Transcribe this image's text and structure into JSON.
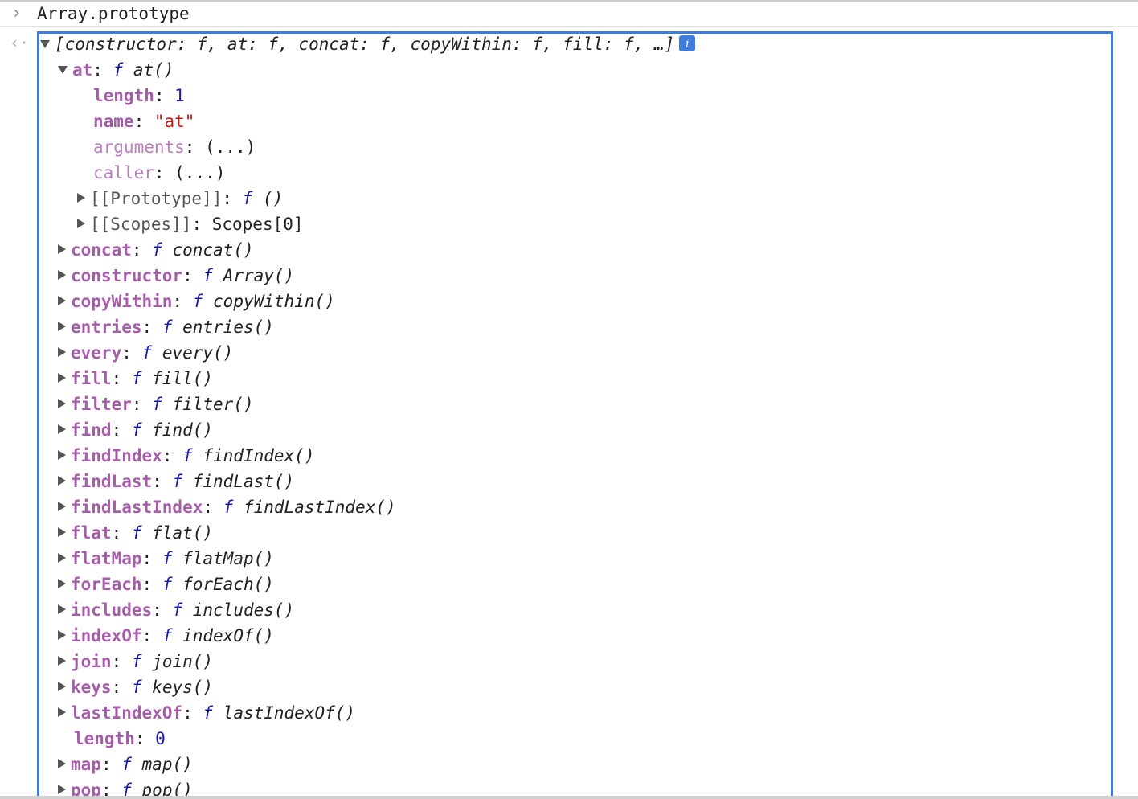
{
  "console": {
    "input_expression": "Array.prototype",
    "summary_preview": "[constructor: f, at: f, concat: f, copyWithin: f, fill: f, …]",
    "info_badge": "i",
    "expanded_at": {
      "key": "at",
      "value": "at()",
      "children": [
        {
          "key": "length",
          "value": "1"
        },
        {
          "key": "name",
          "value": "\"at\""
        },
        {
          "key": "arguments",
          "value": "(...)"
        },
        {
          "key": "caller",
          "value": "(...)"
        },
        {
          "key": "[[Prototype]]",
          "value": "()"
        },
        {
          "key": "[[Scopes]]",
          "value": "Scopes[0]"
        }
      ]
    },
    "function_symbol": "f",
    "properties": [
      {
        "key": "concat",
        "value": "concat()"
      },
      {
        "key": "constructor",
        "value": "Array()"
      },
      {
        "key": "copyWithin",
        "value": "copyWithin()"
      },
      {
        "key": "entries",
        "value": "entries()"
      },
      {
        "key": "every",
        "value": "every()"
      },
      {
        "key": "fill",
        "value": "fill()"
      },
      {
        "key": "filter",
        "value": "filter()"
      },
      {
        "key": "find",
        "value": "find()"
      },
      {
        "key": "findIndex",
        "value": "findIndex()"
      },
      {
        "key": "findLast",
        "value": "findLast()"
      },
      {
        "key": "findLastIndex",
        "value": "findLastIndex()"
      },
      {
        "key": "flat",
        "value": "flat()"
      },
      {
        "key": "flatMap",
        "value": "flatMap()"
      },
      {
        "key": "forEach",
        "value": "forEach()"
      },
      {
        "key": "includes",
        "value": "includes()"
      },
      {
        "key": "indexOf",
        "value": "indexOf()"
      },
      {
        "key": "join",
        "value": "join()"
      },
      {
        "key": "keys",
        "value": "keys()"
      },
      {
        "key": "lastIndexOf",
        "value": "lastIndexOf()"
      }
    ],
    "length_property": {
      "key": "length",
      "value": "0"
    },
    "trailing_properties": [
      {
        "key": "map",
        "value": "map()"
      },
      {
        "key": "pop",
        "value": "pop()"
      }
    ]
  }
}
